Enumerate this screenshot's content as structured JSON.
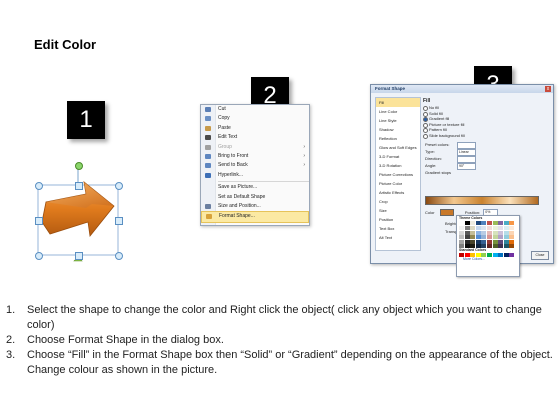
{
  "title": "Edit Color",
  "badges": [
    "1",
    "2",
    "3"
  ],
  "context_menu": {
    "items": [
      {
        "label": "Cut",
        "icon": "scissors-icon",
        "color": "#5b7fb5",
        "disabled": false,
        "submenu": false
      },
      {
        "label": "Copy",
        "icon": "copy-icon",
        "color": "#6a8fc4",
        "disabled": false,
        "submenu": false
      },
      {
        "label": "Paste",
        "icon": "paste-icon",
        "color": "#c79a4a",
        "disabled": false,
        "submenu": false
      },
      {
        "label": "Edit Text",
        "icon": "edit-text-icon",
        "color": "#4a4a4a",
        "disabled": false,
        "submenu": false
      },
      {
        "label": "Group",
        "icon": "group-icon",
        "color": "#a0a0a0",
        "disabled": true,
        "submenu": true
      },
      {
        "label": "Bring to Front",
        "icon": "bring-front-icon",
        "color": "#5e86c0",
        "disabled": false,
        "submenu": true
      },
      {
        "label": "Send to Back",
        "icon": "send-back-icon",
        "color": "#5e86c0",
        "disabled": false,
        "submenu": true
      },
      {
        "label": "Hyperlink...",
        "icon": "hyperlink-icon",
        "color": "#3d6fb6",
        "disabled": false,
        "submenu": false
      },
      {
        "label": "Save as Picture...",
        "icon": "",
        "color": "",
        "disabled": false,
        "submenu": false
      },
      {
        "label": "Set as Default Shape",
        "icon": "",
        "color": "",
        "disabled": false,
        "submenu": false
      },
      {
        "label": "Size and Position...",
        "icon": "size-position-icon",
        "color": "#6b7fa0",
        "disabled": false,
        "submenu": false
      },
      {
        "label": "Format Shape...",
        "icon": "format-shape-icon",
        "color": "#d7a23a",
        "disabled": false,
        "submenu": false,
        "highlighted": true
      }
    ]
  },
  "dialog": {
    "title": "Format Shape",
    "close": "x",
    "nav": [
      "Fill",
      "Line Color",
      "Line Style",
      "Shadow",
      "Reflection",
      "Glow and Soft Edges",
      "3-D Format",
      "3-D Rotation",
      "Picture Corrections",
      "Picture Color",
      "Artistic Effects",
      "Crop",
      "Size",
      "Position",
      "Text Box",
      "Alt Text"
    ],
    "selected_nav": "Fill",
    "section_heading": "Fill",
    "options": [
      {
        "label": "No fill",
        "on": false
      },
      {
        "label": "Solid fill",
        "on": false
      },
      {
        "label": "Gradient fill",
        "on": true
      },
      {
        "label": "Picture or texture fill",
        "on": false
      },
      {
        "label": "Pattern fill",
        "on": false
      },
      {
        "label": "Slide background fill",
        "on": false
      }
    ],
    "fields": [
      {
        "label": "Preset colors:",
        "value": ""
      },
      {
        "label": "Type:",
        "value": "Linear"
      },
      {
        "label": "Direction:",
        "value": ""
      },
      {
        "label": "Angle:",
        "value": "90°"
      },
      {
        "label": "Gradient stops",
        "value": ""
      }
    ],
    "color_label": "Color",
    "position_label": "Position:",
    "position_value": "0%",
    "brightness_label": "Brightness:",
    "transparency_label": "Transparency:",
    "rotate_label": "Rotate with shape",
    "close_button": "Close"
  },
  "palette": {
    "theme_label": "Theme Colors",
    "standard_label": "Standard Colors",
    "more_label": "More Colors...",
    "theme_colors": [
      "#ffffff",
      "#000000",
      "#eeece1",
      "#1f497d",
      "#4f81bd",
      "#c0504d",
      "#9bbb59",
      "#8064a2",
      "#4bacc6",
      "#f79646"
    ],
    "shade_rows": [
      [
        "#f2f2f2",
        "#7f7f7f",
        "#ddd9c3",
        "#c6d9f0",
        "#dbe5f1",
        "#f2dcdb",
        "#ebf1dd",
        "#e5e0ec",
        "#dbeef3",
        "#fdeada"
      ],
      [
        "#d8d8d8",
        "#595959",
        "#c4bd97",
        "#8db3e2",
        "#b8cce4",
        "#e5b9b7",
        "#d7e3bc",
        "#ccc1d9",
        "#b7dde8",
        "#fbd5b5"
      ],
      [
        "#bfbfbf",
        "#3f3f3f",
        "#938953",
        "#548dd4",
        "#95b3d7",
        "#d99694",
        "#c3d69b",
        "#b2a2c7",
        "#92cddc",
        "#fac08f"
      ],
      [
        "#a5a5a5",
        "#262626",
        "#494429",
        "#17365d",
        "#366092",
        "#953734",
        "#76923c",
        "#5f497a",
        "#31859b",
        "#e36c09"
      ],
      [
        "#7f7f7f",
        "#0c0c0c",
        "#1d1b10",
        "#0f243e",
        "#244061",
        "#632423",
        "#4f6128",
        "#3f3151",
        "#205867",
        "#974806"
      ]
    ],
    "standard_colors": [
      "#c00000",
      "#ff0000",
      "#ffc000",
      "#ffff00",
      "#92d050",
      "#00b050",
      "#00b0f0",
      "#0070c0",
      "#002060",
      "#7030a0"
    ]
  },
  "instructions": [
    {
      "num": "1.",
      "text": "Select the shape to change the color and Right click the object( click any object which you want to change color)"
    },
    {
      "num": "2.",
      "text": "Choose Format Shape in the dialog box."
    },
    {
      "num": "3.",
      "text": "Choose “Fill” in the Format Shape box then “Solid” or “Gradient” depending on the appearance of the object. Change colour as shown in the picture."
    }
  ]
}
